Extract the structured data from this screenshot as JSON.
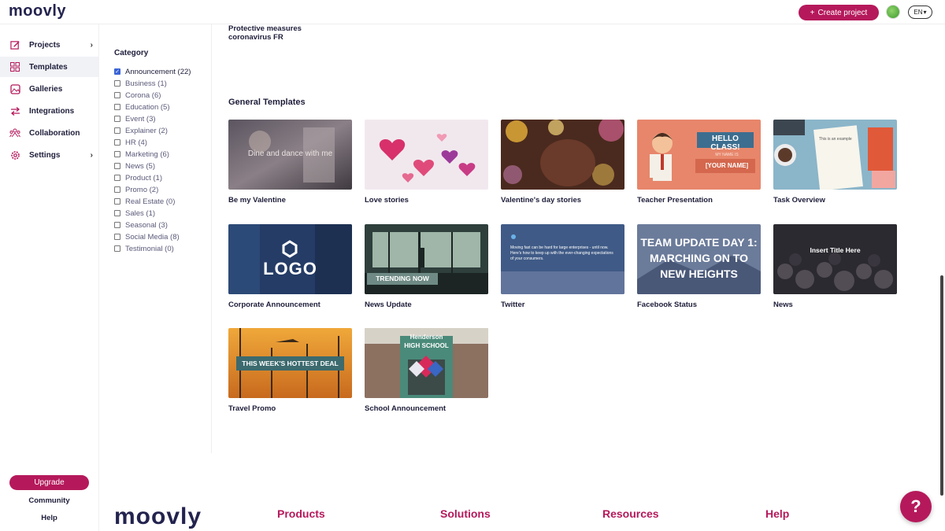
{
  "header": {
    "logo": "moovly",
    "create_label": "Create project",
    "lang": "EN"
  },
  "sidebar": {
    "items": [
      {
        "label": "Projects",
        "icon": "edit-icon",
        "chevron": true
      },
      {
        "label": "Templates",
        "icon": "grid-icon",
        "chevron": false,
        "active": true
      },
      {
        "label": "Galleries",
        "icon": "gallery-icon",
        "chevron": false
      },
      {
        "label": "Integrations",
        "icon": "arrows-icon",
        "chevron": false
      },
      {
        "label": "Collaboration",
        "icon": "people-icon",
        "chevron": false
      },
      {
        "label": "Settings",
        "icon": "gear-icon",
        "chevron": true
      }
    ],
    "upgrade_label": "Upgrade",
    "community_label": "Community",
    "help_label": "Help"
  },
  "category": {
    "title": "Category",
    "items": [
      {
        "label": "Announcement (22)",
        "checked": true
      },
      {
        "label": "Business (1)",
        "checked": false
      },
      {
        "label": "Corona (6)",
        "checked": false
      },
      {
        "label": "Education (5)",
        "checked": false
      },
      {
        "label": "Event (3)",
        "checked": false
      },
      {
        "label": "Explainer (2)",
        "checked": false
      },
      {
        "label": "HR (4)",
        "checked": false
      },
      {
        "label": "Marketing (6)",
        "checked": false
      },
      {
        "label": "News (5)",
        "checked": false
      },
      {
        "label": "Product (1)",
        "checked": false
      },
      {
        "label": "Promo (2)",
        "checked": false
      },
      {
        "label": "Real Estate (0)",
        "checked": false
      },
      {
        "label": "Sales (1)",
        "checked": false
      },
      {
        "label": "Seasonal (3)",
        "checked": false
      },
      {
        "label": "Social Media (8)",
        "checked": false
      },
      {
        "label": "Testimonial (0)",
        "checked": false
      }
    ]
  },
  "content": {
    "prev_title": "Protective measures coronavirus FR",
    "section_title": "General Templates",
    "templates": [
      {
        "label": "Be my Valentine",
        "overlay": "Dine and dance with me"
      },
      {
        "label": "Love stories",
        "overlay": ""
      },
      {
        "label": "Valentine's day stories",
        "overlay": ""
      },
      {
        "label": "Teacher Presentation",
        "overlay": "HELLO CLASS!",
        "overlay2": "MY NAME IS",
        "overlay3": "[YOUR NAME]"
      },
      {
        "label": "Task Overview",
        "overlay": "This is an example"
      },
      {
        "label": "Corporate Announcement",
        "overlay": "LOGO"
      },
      {
        "label": "News Update",
        "overlay": "TRENDING NOW"
      },
      {
        "label": "Twitter",
        "overlay": "Moving fast can be hard for large enterprises - until now. Here's how to keep up with the ever-changing expectations of your consumers."
      },
      {
        "label": "Facebook Status",
        "overlay": "TEAM UPDATE DAY 1:",
        "overlay2": "MARCHING ON TO",
        "overlay3": "NEW HEIGHTS"
      },
      {
        "label": "News",
        "overlay": "Insert Title Here"
      },
      {
        "label": "Travel Promo",
        "overlay": "THIS WEEK'S HOTTEST DEAL"
      },
      {
        "label": "School Announcement",
        "overlay": "Henderson",
        "overlay2": "HIGH SCHOOL"
      }
    ]
  },
  "footer": {
    "logo": "moovly",
    "links": [
      "Products",
      "Solutions",
      "Resources",
      "Help"
    ]
  },
  "help_fab": "?",
  "colors": {
    "brand": "#b5195b",
    "navy": "#23234f"
  }
}
